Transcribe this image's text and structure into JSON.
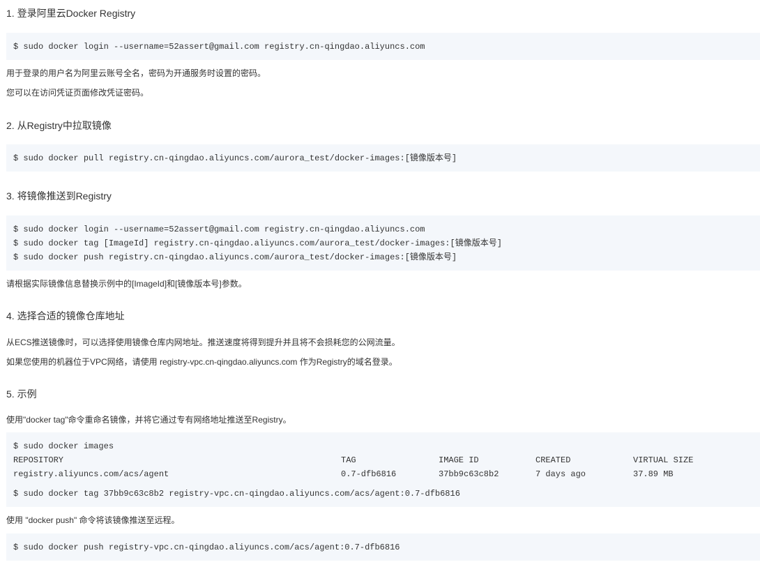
{
  "sections": [
    {
      "heading": "1. 登录阿里云Docker Registry",
      "code": [
        "$ sudo docker login --username=52assert@gmail.com registry.cn-qingdao.aliyuncs.com"
      ],
      "notes": [
        "用于登录的用户名为阿里云账号全名，密码为开通服务时设置的密码。",
        "您可以在访问凭证页面修改凭证密码。"
      ]
    },
    {
      "heading": "2. 从Registry中拉取镜像",
      "code": [
        "$ sudo docker pull registry.cn-qingdao.aliyuncs.com/aurora_test/docker-images:[镜像版本号]"
      ]
    },
    {
      "heading": "3. 将镜像推送到Registry",
      "code": [
        "$ sudo docker login --username=52assert@gmail.com registry.cn-qingdao.aliyuncs.com",
        "$ sudo docker tag [ImageId] registry.cn-qingdao.aliyuncs.com/aurora_test/docker-images:[镜像版本号]",
        "$ sudo docker push registry.cn-qingdao.aliyuncs.com/aurora_test/docker-images:[镜像版本号]"
      ],
      "notes": [
        "请根据实际镜像信息替换示例中的[ImageId]和[镜像版本号]参数。"
      ]
    },
    {
      "heading": "4. 选择合适的镜像仓库地址",
      "notes": [
        "从ECS推送镜像时，可以选择使用镜像仓库内网地址。推送速度将得到提升并且将不会损耗您的公网流量。",
        "如果您使用的机器位于VPC网络，请使用 registry-vpc.cn-qingdao.aliyuncs.com 作为Registry的域名登录。"
      ]
    },
    {
      "heading": "5. 示例",
      "notes": [
        "使用\"docker tag\"命令重命名镜像，并将它通过专有网络地址推送至Registry。"
      ],
      "example": {
        "cmd_images": "$ sudo docker images",
        "headers": [
          "REPOSITORY",
          "TAG",
          "IMAGE ID",
          "CREATED",
          "VIRTUAL SIZE"
        ],
        "row": [
          "registry.aliyuncs.com/acs/agent",
          "0.7-dfb6816",
          "37bb9c63c8b2",
          "7 days ago",
          "37.89 MB"
        ],
        "cmd_tag": "$ sudo docker tag 37bb9c63c8b2 registry-vpc.cn-qingdao.aliyuncs.com/acs/agent:0.7-dfb6816"
      },
      "push_note": "使用 \"docker push\" 命令将该镜像推送至远程。",
      "push_cmd": "$ sudo docker push registry-vpc.cn-qingdao.aliyuncs.com/acs/agent:0.7-dfb6816"
    }
  ],
  "colors": {
    "code_background": "#f4f7fb",
    "text": "#333333",
    "page_background": "#ffffff"
  }
}
